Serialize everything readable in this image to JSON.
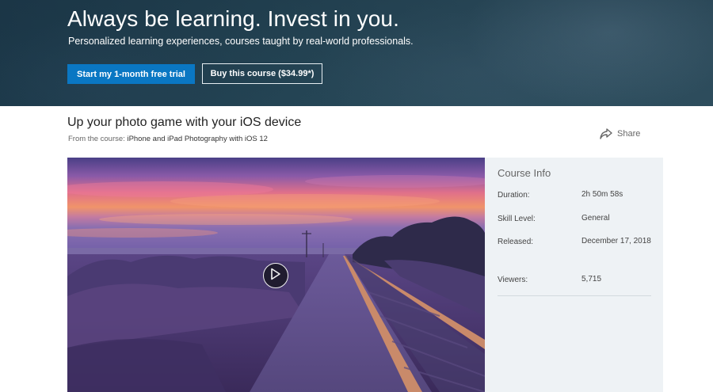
{
  "hero": {
    "title": "Always be learning. Invest in you.",
    "subtitle": "Personalized learning experiences, courses taught by real-world professionals.",
    "trial_button": "Start my 1-month free trial",
    "buy_button": "Buy this course ($34.99*)"
  },
  "video_header": {
    "title": "Up your photo game with your iOS device",
    "from_course_prefix": "From the course:",
    "course_name": "iPhone and iPad Photography with iOS 12",
    "share_label": "Share"
  },
  "video": {
    "play_icon": "play-icon"
  },
  "course_info": {
    "heading": "Course Info",
    "rows": [
      {
        "label": "Duration:",
        "value": "2h 50m 58s"
      },
      {
        "label": "Skill Level:",
        "value": "General"
      },
      {
        "label": "Released:",
        "value": "December 17, 2018"
      },
      {
        "label": "Viewers:",
        "value": "5,715"
      }
    ]
  },
  "colors": {
    "primary_button": "#0a77c3",
    "hero_background": "#254656",
    "info_panel": "#eef2f5"
  }
}
